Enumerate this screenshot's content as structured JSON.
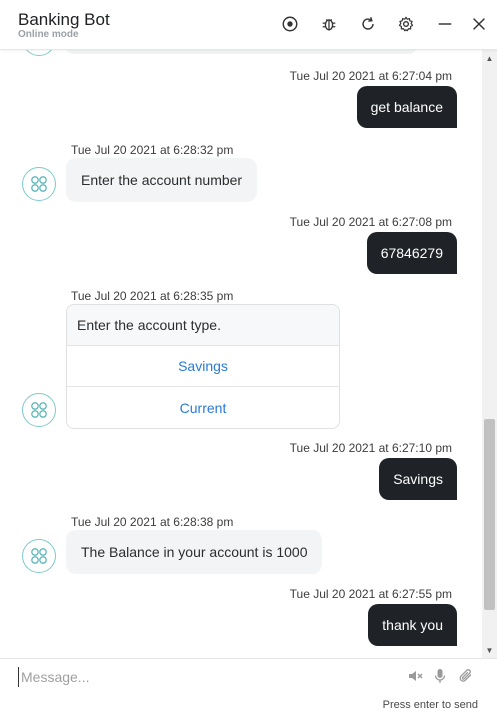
{
  "header": {
    "title": "Banking Bot",
    "subtitle": "Online mode"
  },
  "messages": [
    {
      "type": "user",
      "time": "Tue Jul 20 2021 at 6:27:04 pm",
      "text": "get balance"
    },
    {
      "type": "bot",
      "time": "Tue Jul 20 2021 at 6:28:32 pm",
      "text": "Enter the account number"
    },
    {
      "type": "user",
      "time": "Tue Jul 20 2021 at 6:27:08 pm",
      "text": "67846279"
    },
    {
      "type": "bot-card",
      "time": "Tue Jul 20 2021 at 6:28:35 pm",
      "text": "Enter the account type.",
      "options": [
        "Savings",
        "Current"
      ]
    },
    {
      "type": "user",
      "time": "Tue Jul 20 2021 at 6:27:10 pm",
      "text": "Savings"
    },
    {
      "type": "bot",
      "time": "Tue Jul 20 2021 at 6:28:38 pm",
      "text": "The Balance in your account is 1000"
    },
    {
      "type": "user",
      "time": "Tue Jul 20 2021 at 6:27:55 pm",
      "text": "thank you"
    }
  ],
  "composer": {
    "placeholder": "Message...",
    "hint": "Press enter to send"
  },
  "icons": {
    "header": [
      "record-icon",
      "bug-icon",
      "refresh-icon",
      "settings-icon",
      "minimize-icon",
      "close-icon"
    ],
    "composer": [
      "speaker-muted-icon",
      "microphone-icon",
      "attachment-icon"
    ]
  },
  "colors": {
    "user_bubble": "#1f2328",
    "bot_bubble": "#f3f4f5",
    "link": "#2a7ad6",
    "avatar_accent": "#7fc9c9"
  }
}
